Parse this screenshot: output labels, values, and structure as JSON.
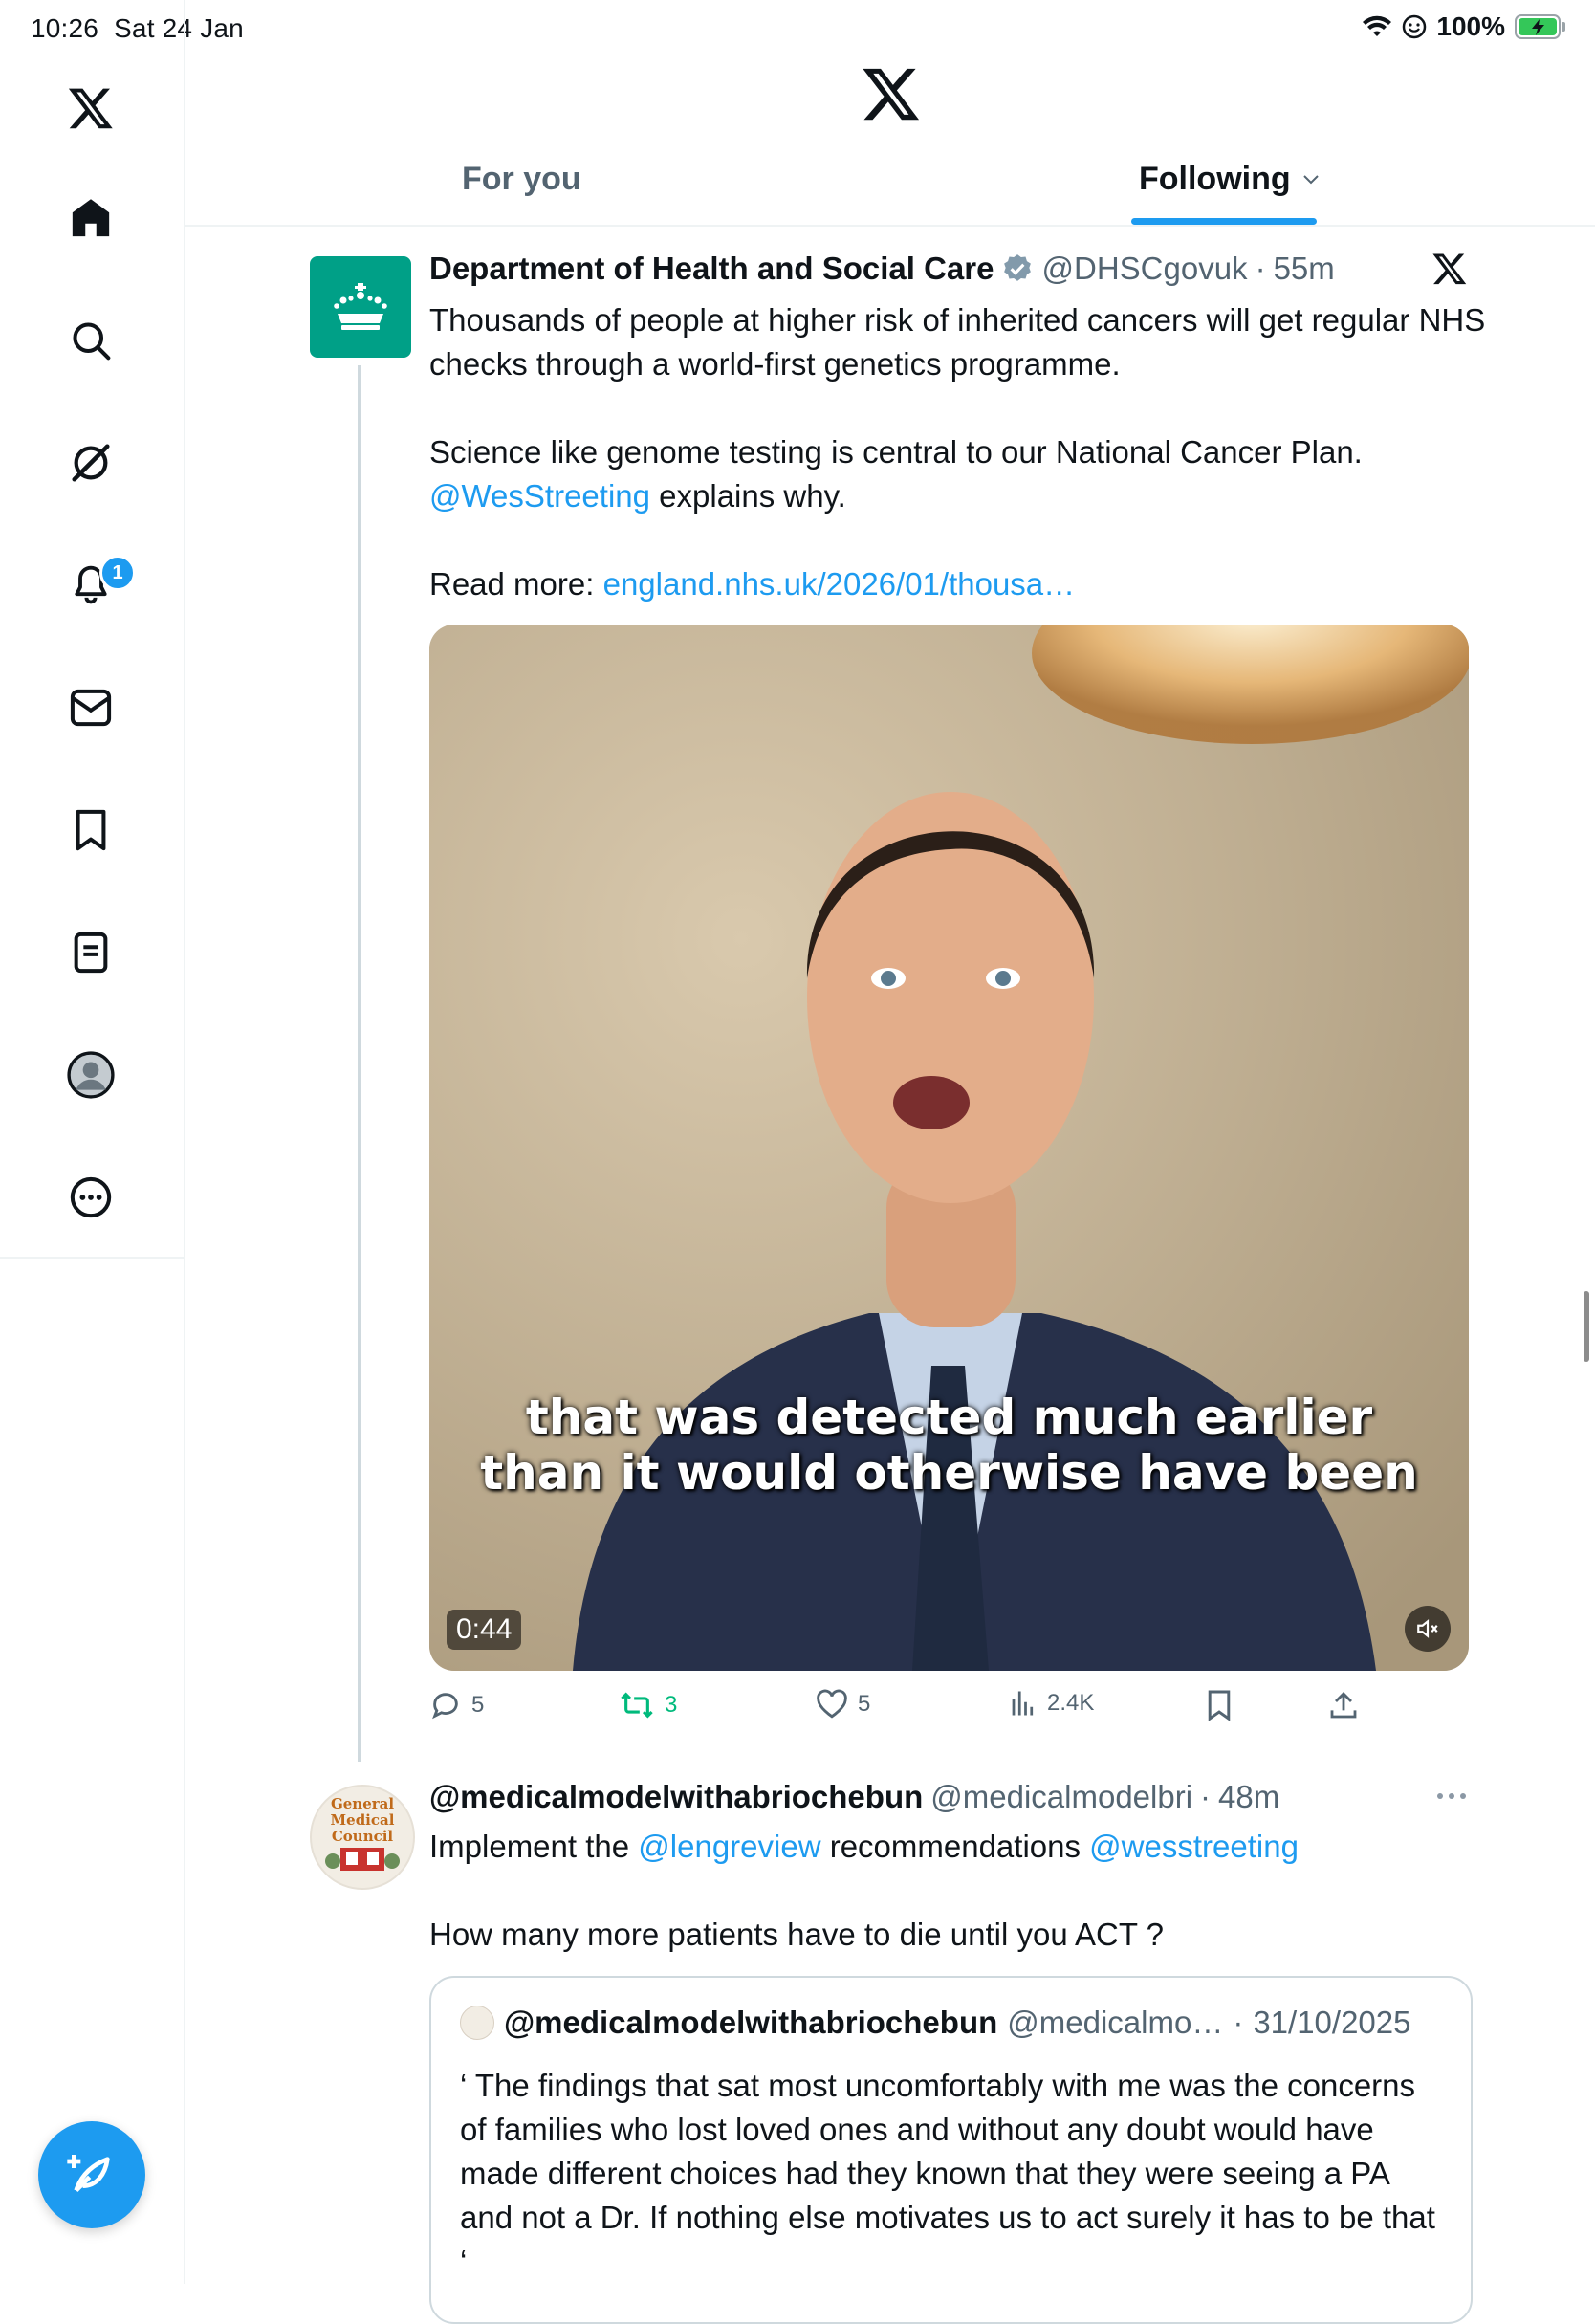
{
  "status_bar": {
    "time": "10:26",
    "date": "Sat 24 Jan",
    "battery": "100%"
  },
  "sidebar": {
    "items": [
      {
        "icon": "x-logo-icon"
      },
      {
        "icon": "home-icon"
      },
      {
        "icon": "search-icon"
      },
      {
        "icon": "grok-icon"
      },
      {
        "icon": "notifications-icon",
        "badge": "1"
      },
      {
        "icon": "messages-icon"
      },
      {
        "icon": "bookmarks-icon"
      },
      {
        "icon": "lists-icon"
      },
      {
        "icon": "profile-icon"
      },
      {
        "icon": "more-icon"
      }
    ],
    "compose_icon": "compose-icon"
  },
  "header": {
    "tabs": [
      {
        "label": "For you",
        "active": false
      },
      {
        "label": "Following",
        "active": true
      }
    ]
  },
  "tweets": [
    {
      "name": "Department of Health and Social Care",
      "verified": true,
      "handle": "@DHSCgovuk",
      "time": "55m",
      "text_p1": "Thousands of people at higher risk of inherited cancers will get regular NHS checks through a world-first genetics programme.",
      "text_p2a": "Science like genome testing is central to our National Cancer Plan.",
      "mention": "@WesStreeting",
      "text_p2b": " explains why.",
      "readmore_label": "Read more: ",
      "readmore_link": "england.nhs.uk/2026/01/thousa…",
      "video": {
        "caption_line1": "that was detected much earlier",
        "caption_line2": "than it would otherwise have been",
        "duration": "0:44"
      },
      "stats": {
        "replies": "5",
        "reposts": "3",
        "likes": "5",
        "views": "2.4K"
      }
    },
    {
      "name": "@medicalmodelwithabriochebun",
      "handle": "@medicalmodelbri",
      "time": "48m",
      "text_a": "Implement the ",
      "mention1": "@lengreview",
      "text_b": " recommendations ",
      "mention2": "@wesstreeting",
      "text_p2": "How many more patients have to die until you ACT ?",
      "avatar_text": [
        "General",
        "Medical",
        "Council"
      ],
      "quote": {
        "name": "@medicalmodelwithabriochebun",
        "handle": "@medicalmo…",
        "date": "31/10/2025",
        "text": "‘ The findings that sat most uncomfortably with me was the concerns of families who lost loved ones and without any doubt would have made different choices had they known that they were seeing a PA and not a Dr. If nothing else motivates us to act surely it has to be that ‘"
      }
    }
  ],
  "colors": {
    "accent": "#1d9bf0",
    "repost_green": "#00ba7c",
    "dhsc_green": "#00a087",
    "text": "#0f1419",
    "muted": "#536471"
  }
}
